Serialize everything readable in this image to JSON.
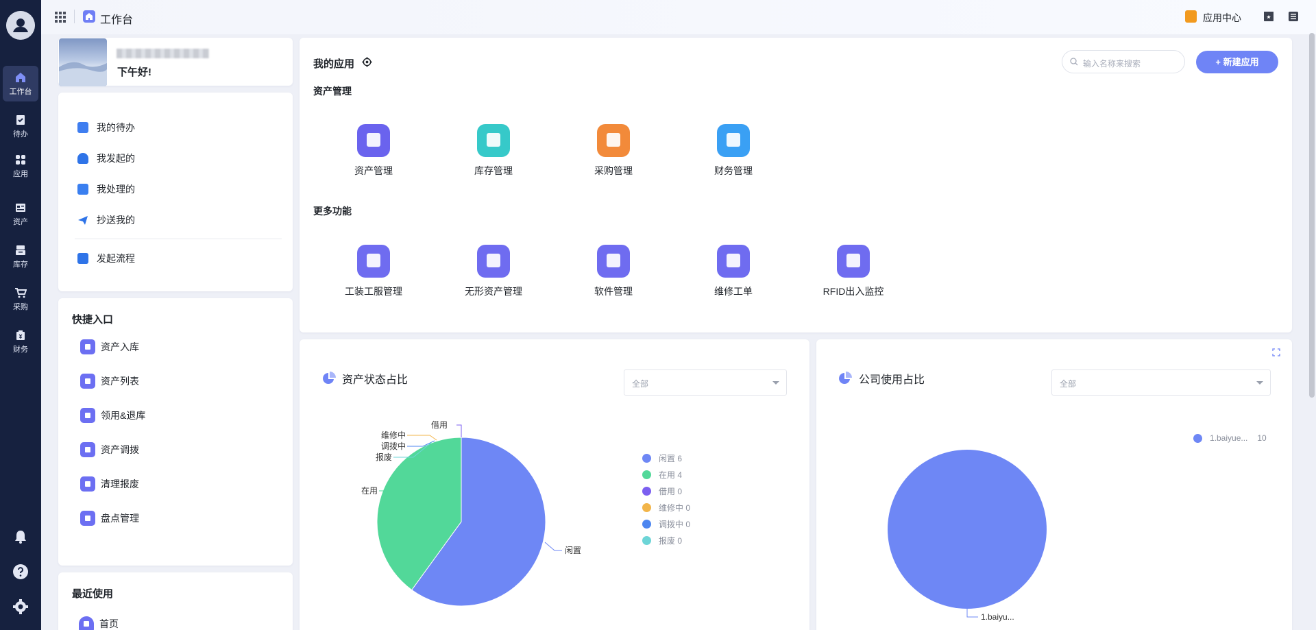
{
  "topbar": {
    "title": "工作台",
    "app_center": "应用中心"
  },
  "rail": {
    "items": [
      {
        "label": "工作台",
        "icon": "home-icon"
      },
      {
        "label": "待办",
        "icon": "clipboard-check-icon"
      },
      {
        "label": "应用",
        "icon": "apps-icon"
      },
      {
        "label": "资产",
        "icon": "asset-icon"
      },
      {
        "label": "库存",
        "icon": "inventory-icon"
      },
      {
        "label": "采购",
        "icon": "cart-icon"
      },
      {
        "label": "财务",
        "icon": "finance-icon"
      }
    ],
    "bottom_icons": [
      "bell-icon",
      "help-icon",
      "settings-icon"
    ]
  },
  "profile": {
    "greeting": "下午好!"
  },
  "todo_menu": {
    "items": [
      {
        "label": "我的待办",
        "icon": "calendar-icon",
        "color": "#3f7ef0"
      },
      {
        "label": "我发起的",
        "icon": "user-icon",
        "color": "#2f74e8"
      },
      {
        "label": "我处理的",
        "icon": "check-icon",
        "color": "#3a7ff0"
      },
      {
        "label": "抄送我的",
        "icon": "send-icon",
        "color": "#2f74e8"
      }
    ],
    "start_flow": "发起流程"
  },
  "quick_entry": {
    "title": "快捷入口",
    "items": [
      "资产入库",
      "资产列表",
      "领用&退库",
      "资产调拨",
      "清理报废",
      "盘点管理"
    ]
  },
  "recent": {
    "title": "最近使用",
    "items": [
      "首页"
    ]
  },
  "my_apps": {
    "title": "我的应用",
    "search_placeholder": "输入名称来搜索",
    "new_button": "+ 新建应用",
    "asset_section": "资产管理",
    "asset_apps": [
      {
        "label": "资产管理",
        "color": "#6a63ee"
      },
      {
        "label": "库存管理",
        "color": "#36c9c9"
      },
      {
        "label": "采购管理",
        "color": "#f28a3a"
      },
      {
        "label": "财务管理",
        "color": "#3aa0f4"
      }
    ],
    "more_section": "更多功能",
    "more_apps": [
      {
        "label": "工装工服管理",
        "color": "#6f6cf0"
      },
      {
        "label": "无形资产管理",
        "color": "#6f6cf0"
      },
      {
        "label": "软件管理",
        "color": "#6f6cf0"
      },
      {
        "label": "维修工单",
        "color": "#6f6cf0"
      },
      {
        "label": "RFID出入监控",
        "color": "#6f6cf0"
      }
    ]
  },
  "status_panel": {
    "title": "资产状态占比",
    "select_value": "全部",
    "legend": [
      {
        "label": "闲置 6",
        "color": "#6e87f5"
      },
      {
        "label": "在用 4",
        "color": "#52d899"
      },
      {
        "label": "借用 0",
        "color": "#7b5ff0"
      },
      {
        "label": "维修中 0",
        "color": "#f2b54a"
      },
      {
        "label": "调拨中 0",
        "color": "#4c86f0"
      },
      {
        "label": "报废 0",
        "color": "#6dd5d7"
      }
    ],
    "callouts": [
      "借用",
      "维修中",
      "调拨中",
      "报废",
      "在用",
      "闲置"
    ]
  },
  "company_panel": {
    "title": "公司使用占比",
    "select_value": "全部",
    "legend": [
      {
        "label": "1.baiyue...",
        "value_text": "10",
        "color": "#6e87f5"
      }
    ],
    "callout": "1.baiyu..."
  },
  "chart_data": [
    {
      "type": "pie",
      "title": "资产状态占比",
      "categories": [
        "闲置",
        "在用",
        "借用",
        "维修中",
        "调拨中",
        "报废"
      ],
      "values": [
        6,
        4,
        0,
        0,
        0,
        0
      ],
      "colors": [
        "#6e87f5",
        "#52d899",
        "#7b5ff0",
        "#f2b54a",
        "#4c86f0",
        "#6dd5d7"
      ],
      "legend": "right"
    },
    {
      "type": "pie",
      "title": "公司使用占比",
      "categories": [
        "1.baiyue..."
      ],
      "values": [
        10
      ],
      "colors": [
        "#6e87f5"
      ],
      "legend": "top-right"
    }
  ]
}
